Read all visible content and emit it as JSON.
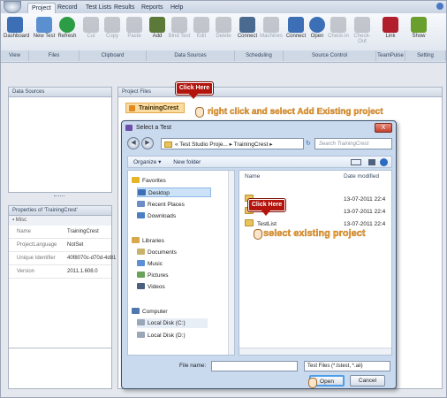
{
  "menu": {
    "tabs": [
      "Project",
      "Record",
      "Test Lists",
      "Results",
      "Reports",
      "Help"
    ],
    "active_tab": "Project"
  },
  "ribbon": {
    "buttons": [
      {
        "label": "Dashboard",
        "icon": "dashboard-icon",
        "color": "#3c6fb5",
        "enabled": true
      },
      {
        "label": "New Test",
        "icon": "new-test-icon",
        "color": "#5a8fd0",
        "enabled": true
      },
      {
        "label": "Refresh",
        "icon": "refresh-icon",
        "color": "#2c9d44",
        "enabled": true
      },
      {
        "label": "Cut",
        "icon": "cut-icon",
        "color": "#8a8f96",
        "enabled": false
      },
      {
        "label": "Copy",
        "icon": "copy-icon",
        "color": "#8a8f96",
        "enabled": false
      },
      {
        "label": "Paste",
        "icon": "paste-icon",
        "color": "#8a8f96",
        "enabled": false
      },
      {
        "label": "Add",
        "icon": "add-icon",
        "color": "#5b7a3a",
        "enabled": true
      },
      {
        "label": "Bind Test",
        "icon": "bind-test-icon",
        "color": "#8a8f96",
        "enabled": false
      },
      {
        "label": "Edit",
        "icon": "edit-icon",
        "color": "#8a8f96",
        "enabled": false
      },
      {
        "label": "Delete",
        "icon": "delete-icon",
        "color": "#8a8f96",
        "enabled": false
      },
      {
        "label": "Connect",
        "icon": "connect-icon",
        "color": "#4b6a8f",
        "enabled": true
      },
      {
        "label": "Machines",
        "icon": "machines-icon",
        "color": "#8a8f96",
        "enabled": false
      },
      {
        "label": "Connect",
        "icon": "connect-plug-icon",
        "color": "#3c6fb5",
        "enabled": true
      },
      {
        "label": "Open",
        "icon": "open-icon",
        "color": "#3c6fb5",
        "enabled": true
      },
      {
        "label": "Check-in",
        "icon": "check-in-icon",
        "color": "#8a8f96",
        "enabled": false
      },
      {
        "label": "Check-Out",
        "icon": "check-out-icon",
        "color": "#8a8f96",
        "enabled": false
      },
      {
        "label": "Link",
        "icon": "link-icon",
        "color": "#b01f2b",
        "enabled": true
      },
      {
        "label": "Show",
        "icon": "show-icon",
        "color": "#6a9e2d",
        "enabled": true
      }
    ],
    "groups": [
      "View",
      "Files",
      "Clipboard",
      "Data Sources",
      "Scheduling",
      "Source Control",
      "TeamPulse",
      "Setting"
    ]
  },
  "panels": {
    "data_sources_title": "Data Sources",
    "properties_title": "Properties of 'TrainingCrest'",
    "misc_label": "Misc",
    "properties": [
      {
        "key": "Name",
        "value": "TrainingCrest"
      },
      {
        "key": "ProjectLanguage",
        "value": "NotSet"
      },
      {
        "key": "Unique Identifier",
        "value": "40f8070c-d70d-4d81"
      },
      {
        "key": "Version",
        "value": "2011.1.608.0"
      }
    ],
    "project_files_title": "Project Files",
    "project_root": "TrainingCrest"
  },
  "callouts": {
    "click_here_1": "Click Here",
    "note_1": "right click and select Add Existing project",
    "click_here_2": "Click Here",
    "note_2": "select existing project"
  },
  "dialog": {
    "title": "Select a Test",
    "close": "X",
    "breadcrumb": "« Test Studio Proje... ▸ TrainingCrest ▸",
    "search_placeholder": "Search TrainingCrest",
    "organize": "Organize ▾",
    "new_folder": "New folder",
    "nav": {
      "favorites": "Favorites",
      "desktop": "Desktop",
      "recent": "Recent Places",
      "downloads": "Downloads",
      "libraries": "Libraries",
      "documents": "Documents",
      "music": "Music",
      "pictures": "Pictures",
      "videos": "Videos",
      "computer": "Computer",
      "disk_c": "Local Disk (C:)",
      "disk_d": "Local Disk (D:)"
    },
    "columns": {
      "name": "Name",
      "date": "Date modified"
    },
    "files": [
      {
        "name": "",
        "date": "13-07-2011 22:4"
      },
      {
        "name": "",
        "date": "13-07-2011 22:4"
      },
      {
        "name": "TestList",
        "date": "13-07-2011 22:4"
      }
    ],
    "file_name_label": "File name:",
    "file_type": "Test Files (*.tstest, *.aii)",
    "open_button": "Open",
    "cancel_button": "Cancel"
  }
}
